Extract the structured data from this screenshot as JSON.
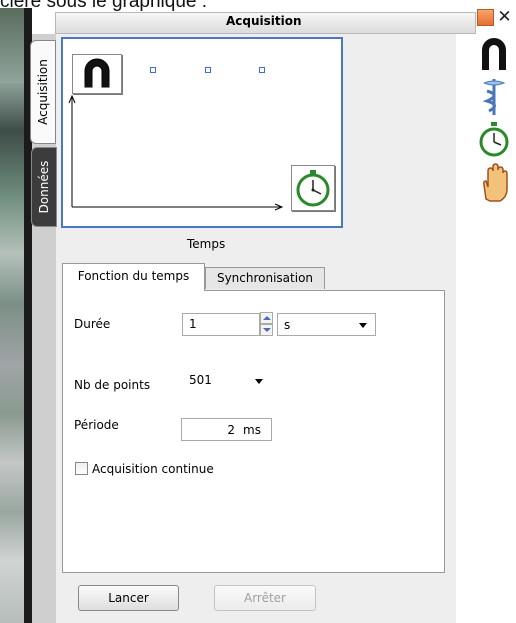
{
  "caption_text": "ciere sous le graphique :",
  "window": {
    "title": "Acquisition"
  },
  "side_tabs": [
    "Acquisition",
    "Données"
  ],
  "graph": {
    "x_axis_label": "Temps"
  },
  "tabs": [
    "Fonction du temps",
    "Synchronisation"
  ],
  "form": {
    "duree_label": "Durée",
    "duree_value": "1",
    "duree_unit": "s",
    "points_label": "Nb de points",
    "points_value": "501",
    "periode_label": "Période",
    "periode_value": "2",
    "periode_unit": "ms",
    "continue_label": "Acquisition continue",
    "continue_checked": false
  },
  "buttons": {
    "start": "Lancer",
    "stop": "Arrêter"
  },
  "toolbar_icons": [
    "magnet-icon",
    "caduceus-icon",
    "stopwatch-icon",
    "hand-icon"
  ],
  "colors": {
    "selection_border": "#4a79c2",
    "close_button": "#e76e2f"
  }
}
